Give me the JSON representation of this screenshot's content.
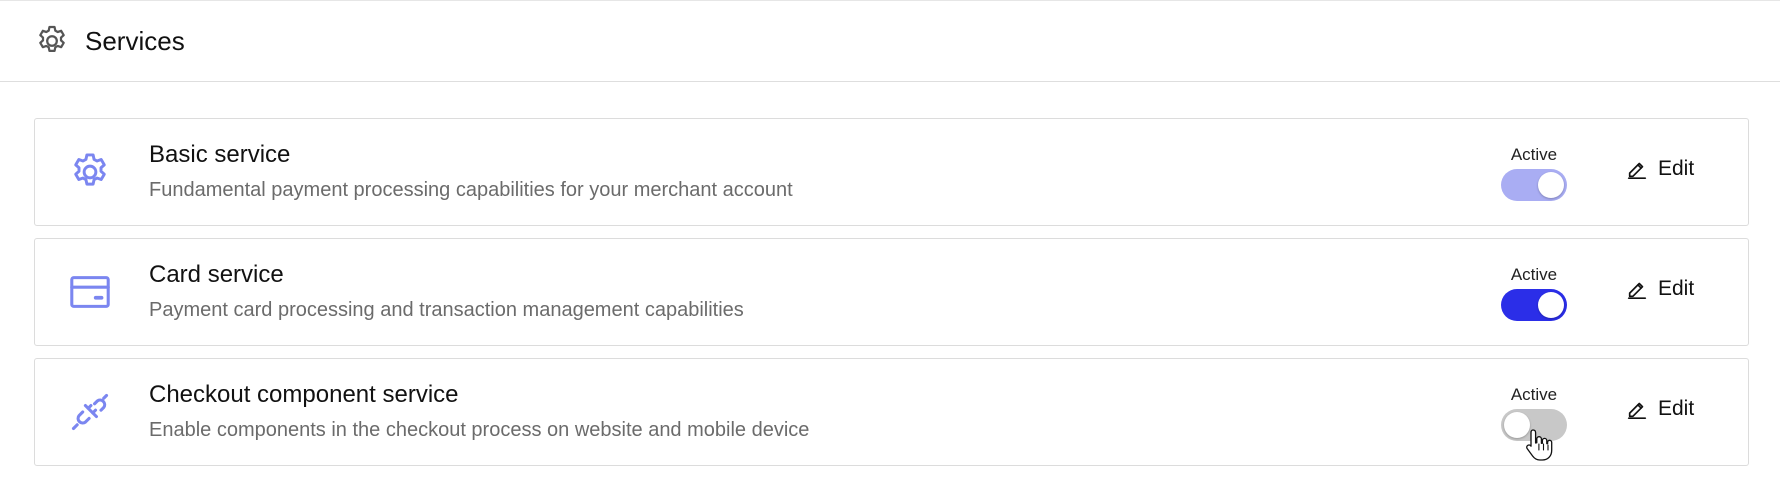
{
  "header": {
    "icon": "gear-icon",
    "title": "Services"
  },
  "colors": {
    "accent_icon": "#7b86f0",
    "toggle_on_strong": "#2b2ee8",
    "toggle_on_soft": "#a9adf3",
    "toggle_off": "#c8c8c8"
  },
  "services": [
    {
      "icon": "gear-icon",
      "name": "Basic service",
      "description": "Fundamental payment processing capabilities for your merchant account",
      "status_label": "Active",
      "active": true,
      "toggle_color": "#a9adf3",
      "edit_label": "Edit"
    },
    {
      "icon": "credit-card-icon",
      "name": "Card service",
      "description": "Payment card processing and transaction management capabilities",
      "status_label": "Active",
      "active": true,
      "toggle_color": "#2b2ee8",
      "edit_label": "Edit"
    },
    {
      "icon": "plug-icon",
      "name": "Checkout component service",
      "description": "Enable components in the checkout process on website and mobile device",
      "status_label": "Active",
      "active": false,
      "toggle_color": "#c8c8c8",
      "edit_label": "Edit"
    }
  ]
}
